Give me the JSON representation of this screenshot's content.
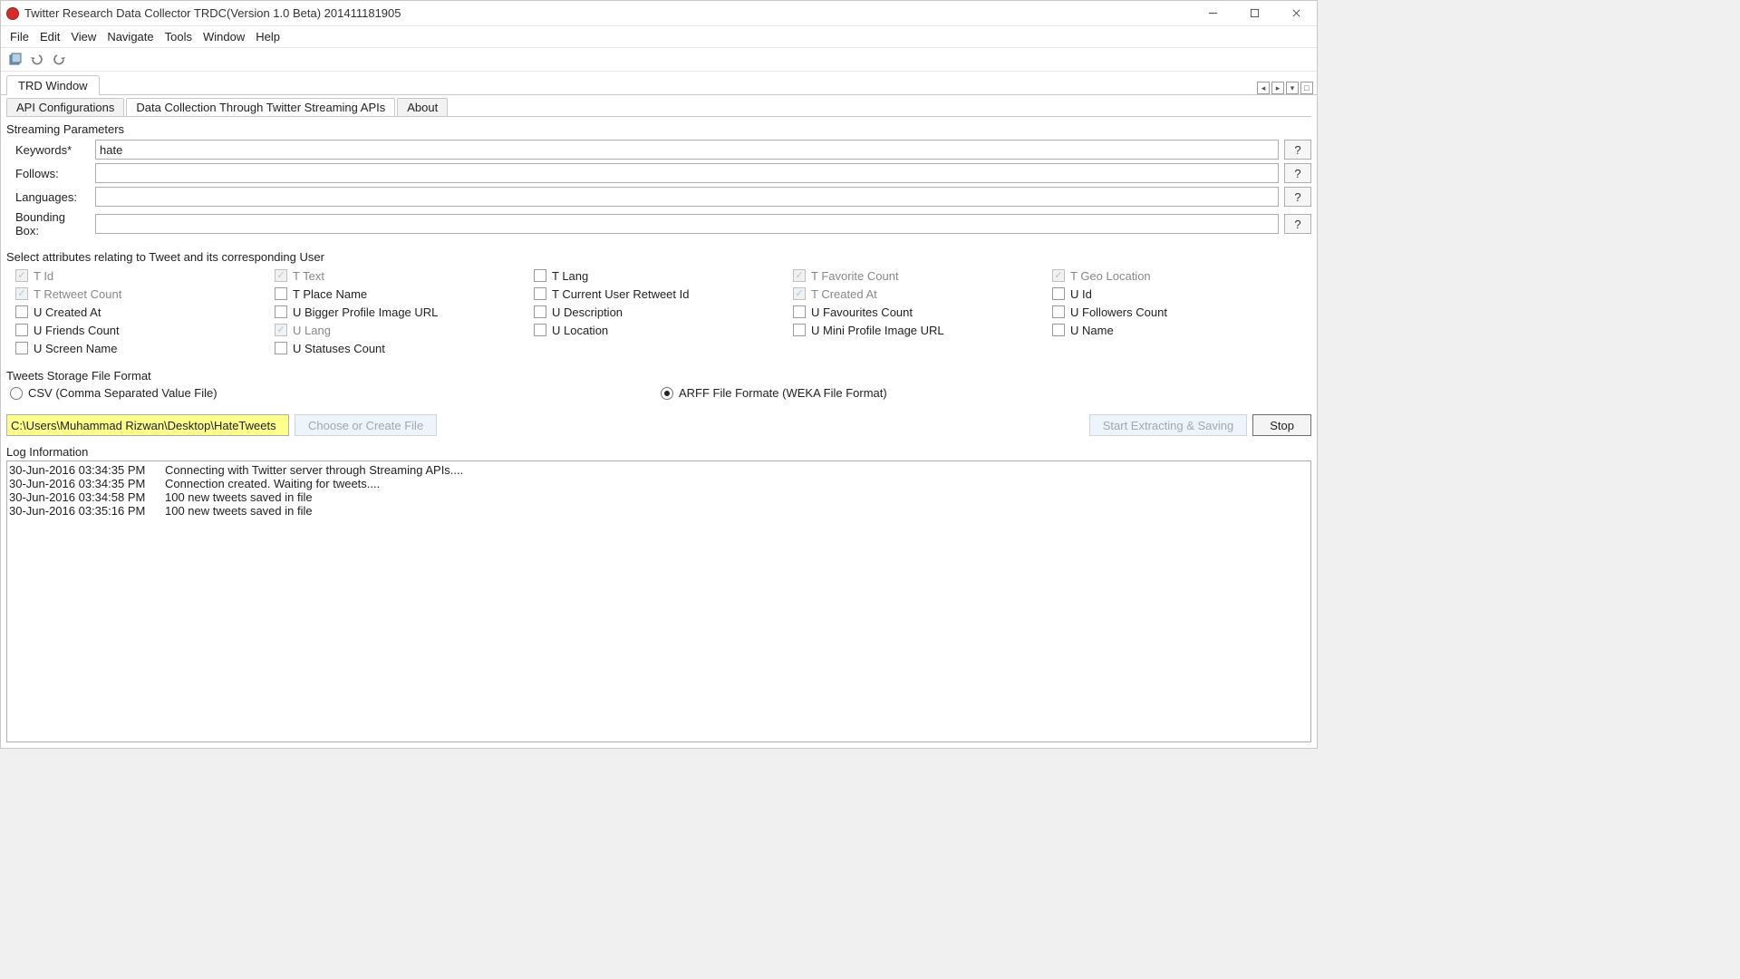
{
  "window": {
    "title": "Twitter Research Data Collector TRDC(Version 1.0 Beta) 201411181905"
  },
  "menus": [
    "File",
    "Edit",
    "View",
    "Navigate",
    "Tools",
    "Window",
    "Help"
  ],
  "editor_tab": "TRD Window",
  "inner_tabs": {
    "api": "API Configurations",
    "data": "Data Collection Through Twitter Streaming APIs",
    "about": "About"
  },
  "streaming": {
    "title": "Streaming Parameters",
    "keywords_label": "Keywords*",
    "keywords_value": "hate",
    "follows_label": "Follows:",
    "follows_value": "",
    "languages_label": "Languages:",
    "languages_value": "",
    "bbox_label": "Bounding Box:",
    "bbox_value": "",
    "help_label": "?"
  },
  "attrs": {
    "title": "Select attributes relating to Tweet and its corresponding User",
    "rows": [
      [
        {
          "label": "T Id",
          "checked": true,
          "disabled": true
        },
        {
          "label": "T Text",
          "checked": true,
          "disabled": true
        },
        {
          "label": "T Lang",
          "checked": false,
          "disabled": false
        },
        {
          "label": "T Favorite Count",
          "checked": true,
          "disabled": true
        },
        {
          "label": "T Geo Location",
          "checked": true,
          "disabled": true
        }
      ],
      [
        {
          "label": "T Retweet Count",
          "checked": true,
          "disabled": true
        },
        {
          "label": "T Place Name",
          "checked": false,
          "disabled": false
        },
        {
          "label": "T Current User Retweet Id",
          "checked": false,
          "disabled": false
        },
        {
          "label": "T Created At",
          "checked": true,
          "disabled": true
        },
        {
          "label": "U Id",
          "checked": false,
          "disabled": false
        }
      ],
      [
        {
          "label": "U Created At",
          "checked": false,
          "disabled": false
        },
        {
          "label": "U Bigger Profile Image URL",
          "checked": false,
          "disabled": false
        },
        {
          "label": "U Description",
          "checked": false,
          "disabled": false
        },
        {
          "label": "U Favourites Count",
          "checked": false,
          "disabled": false
        },
        {
          "label": "U Followers Count",
          "checked": false,
          "disabled": false
        }
      ],
      [
        {
          "label": "U Friends Count",
          "checked": false,
          "disabled": false
        },
        {
          "label": "U Lang",
          "checked": true,
          "disabled": true
        },
        {
          "label": "U Location",
          "checked": false,
          "disabled": false
        },
        {
          "label": "U Mini Profile Image URL",
          "checked": false,
          "disabled": false
        },
        {
          "label": "U Name",
          "checked": false,
          "disabled": false
        }
      ],
      [
        {
          "label": "U Screen Name",
          "checked": false,
          "disabled": false
        },
        {
          "label": "U Statuses Count",
          "checked": false,
          "disabled": false
        }
      ]
    ]
  },
  "format": {
    "title": "Tweets Storage File Format",
    "csv": "CSV (Comma Separated Value File)",
    "arff": "ARFF File Formate (WEKA File Format)",
    "selected": "arff"
  },
  "actions": {
    "filepath": "C:\\Users\\Muhammad Rizwan\\Desktop\\HateTweets",
    "choose": "Choose or Create File",
    "start": "Start Extracting & Saving",
    "stop": "Stop"
  },
  "log": {
    "title": "Log Information",
    "entries": [
      {
        "ts": "30-Jun-2016 03:34:35 PM",
        "msg": "Connecting with Twitter server through Streaming APIs...."
      },
      {
        "ts": "30-Jun-2016 03:34:35 PM",
        "msg": "Connection created. Waiting for tweets...."
      },
      {
        "ts": "30-Jun-2016 03:34:58 PM",
        "msg": "100 new tweets saved in file"
      },
      {
        "ts": "30-Jun-2016 03:35:16 PM",
        "msg": "100 new tweets saved in file"
      }
    ]
  }
}
